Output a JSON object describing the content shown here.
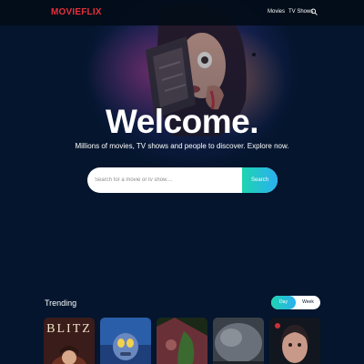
{
  "nav": {
    "logo": "MOVIEFLIX",
    "links": [
      "Movies",
      "TV Shows"
    ],
    "search_icon": "search-icon"
  },
  "hero": {
    "title": "Welcome.",
    "subtitle": "Millions of movies, TV shows and people to discover. Explore now.",
    "search_placeholder": "Search for a movie or tv show....",
    "search_button": "Search"
  },
  "trending": {
    "title": "Trending",
    "tabs": [
      "Day",
      "Week"
    ],
    "active_tab": "Day",
    "posters": [
      {
        "title_text": "BLITZ"
      },
      {
        "title_text": ""
      },
      {
        "title_text": ""
      },
      {
        "title_text": ""
      },
      {
        "title_text": ""
      }
    ]
  },
  "colors": {
    "background": "#04152d",
    "logo": "#e3323a",
    "accent_start": "#1fd4b0",
    "accent_end": "#2ab0f0"
  }
}
